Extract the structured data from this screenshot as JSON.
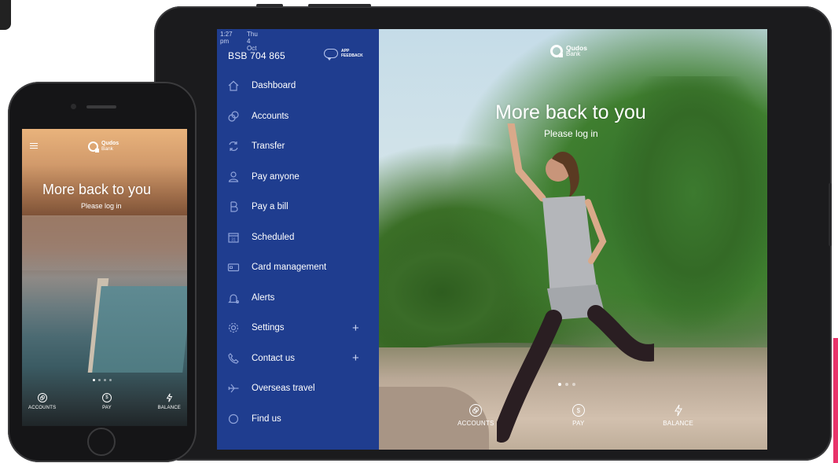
{
  "tablet": {
    "status": {
      "time": "1:27 pm",
      "date": "Thu 4 Oct"
    },
    "bsb": "BSB 704 865",
    "feedback": {
      "line1": "APP",
      "line2": "FEEDBACK"
    },
    "menu": [
      {
        "label": "Dashboard",
        "icon": "home-icon"
      },
      {
        "label": "Accounts",
        "icon": "coins-icon"
      },
      {
        "label": "Transfer",
        "icon": "transfer-icon"
      },
      {
        "label": "Pay anyone",
        "icon": "person-icon"
      },
      {
        "label": "Pay a bill",
        "icon": "bpay-icon"
      },
      {
        "label": "Scheduled",
        "icon": "calendar-icon",
        "icon_text": "31"
      },
      {
        "label": "Card management",
        "icon": "card-icon"
      },
      {
        "label": "Alerts",
        "icon": "bell-icon"
      },
      {
        "label": "Settings",
        "icon": "gear-icon",
        "expand": "+"
      },
      {
        "label": "Contact us",
        "icon": "phone-icon",
        "expand": "+"
      },
      {
        "label": "Overseas travel",
        "icon": "plane-icon"
      },
      {
        "label": "Find us",
        "icon": "location-icon"
      }
    ],
    "brand": {
      "line1": "Qudos",
      "line2": "Bank"
    },
    "hero": {
      "title": "More back to you",
      "subtitle": "Please log in"
    },
    "nav": [
      {
        "label": "ACCOUNTS",
        "icon": "coins-icon"
      },
      {
        "label": "PAY",
        "icon": "dollar-icon",
        "glyph": "$"
      },
      {
        "label": "BALANCE",
        "icon": "bolt-icon"
      }
    ]
  },
  "phone": {
    "brand": {
      "line1": "Qudos",
      "line2": "Bank"
    },
    "hero": {
      "title": "More back to you",
      "subtitle": "Please log in"
    },
    "nav": [
      {
        "label": "ACCOUNTS",
        "icon": "coins-icon"
      },
      {
        "label": "PAY",
        "icon": "dollar-icon",
        "glyph": "$"
      },
      {
        "label": "BALANCE",
        "icon": "bolt-icon"
      }
    ]
  },
  "colors": {
    "menu_bg": "#1f3d8f",
    "accent_pink": "#e8336a"
  }
}
